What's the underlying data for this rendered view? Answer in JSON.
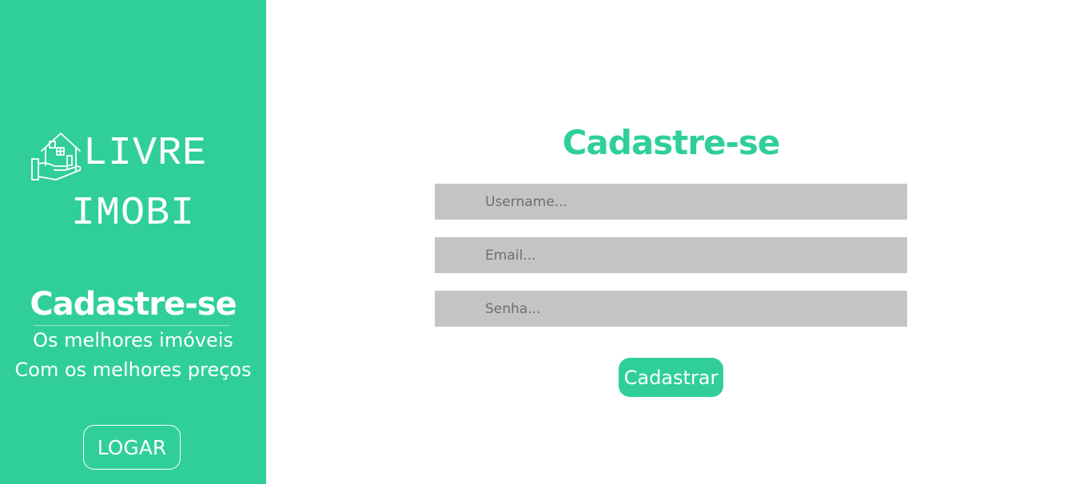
{
  "sidebar": {
    "logo": {
      "icon": "house-hand-icon",
      "line1": "LIVRE",
      "line2": "IMOBI"
    },
    "title": "Cadastre-se",
    "subtitle_line1": "Os melhores imóveis",
    "subtitle_line2": "Com os melhores preços",
    "login_button": "LOGAR"
  },
  "form": {
    "title": "Cadastre-se",
    "username_placeholder": "Username...",
    "email_placeholder": "Email...",
    "password_placeholder": "Senha...",
    "submit_label": "Cadastrar"
  },
  "colors": {
    "accent": "#30cf9a",
    "field_bg": "#c4c4c4",
    "text_light": "#ffffff"
  }
}
